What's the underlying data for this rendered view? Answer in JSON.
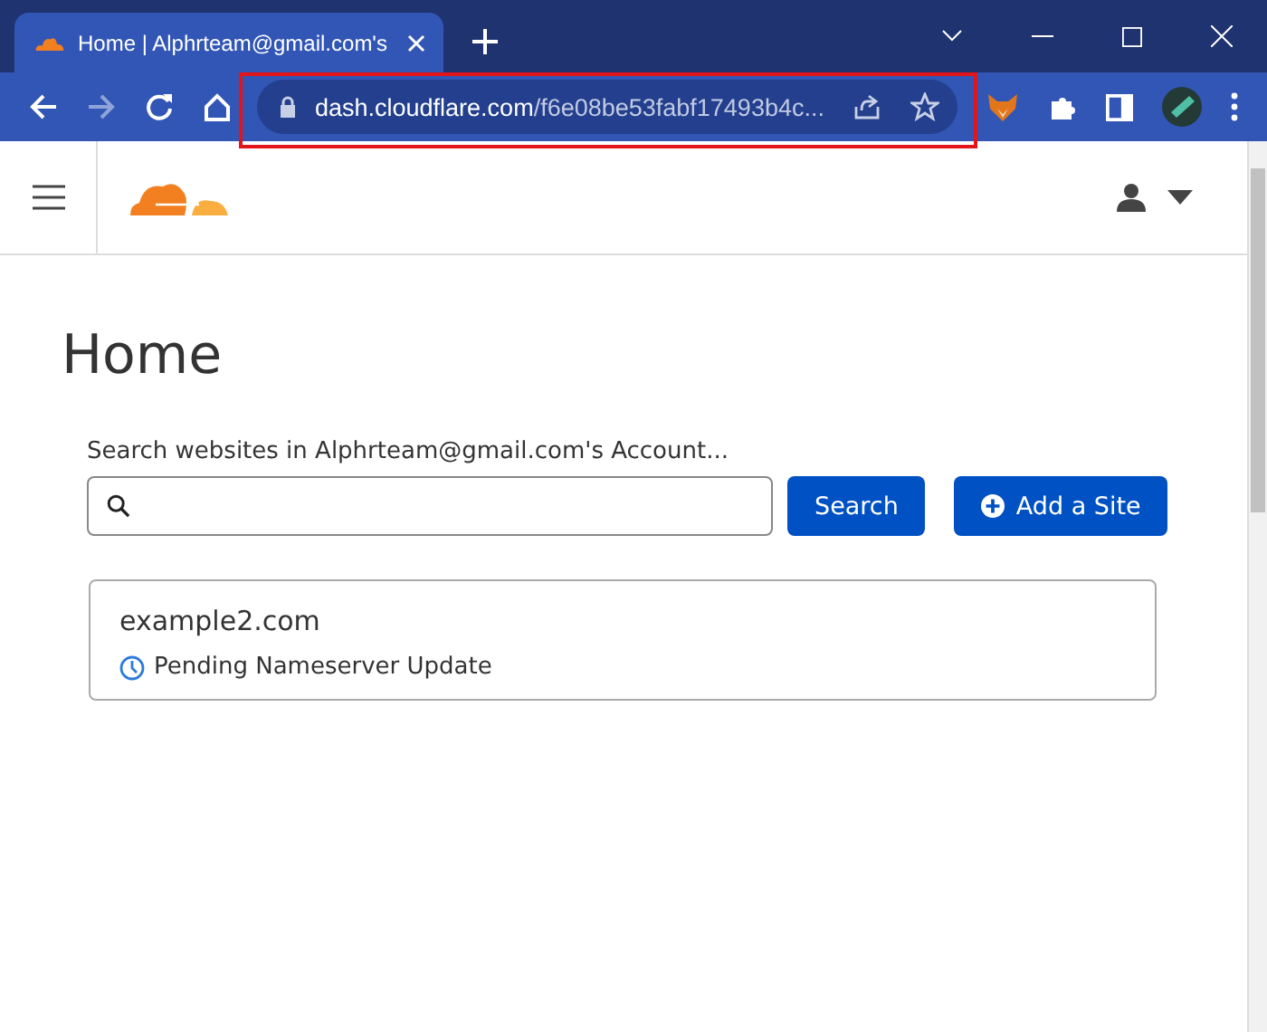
{
  "browser": {
    "tab": {
      "title": "Home | Alphrteam@gmail.com's",
      "selected": true
    },
    "address_bar": {
      "host": "dash.cloudflare.com",
      "path": "/f6e08be53fabf17493b4c...",
      "highlighted": true
    }
  },
  "page": {
    "title": "Home",
    "search": {
      "label": "Search websites in Alphrteam@gmail.com's Account...",
      "button": "Search"
    },
    "add_button": "Add a Site",
    "sites": [
      {
        "domain": "example2.com",
        "status": "Pending Nameserver Update"
      }
    ]
  }
}
